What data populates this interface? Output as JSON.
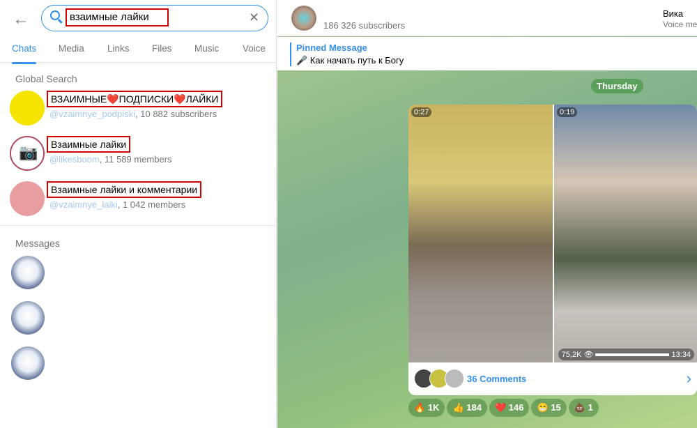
{
  "search": {
    "query": "взаимные лайки"
  },
  "tabs": [
    "Chats",
    "Media",
    "Links",
    "Files",
    "Music",
    "Voice"
  ],
  "global_search_label": "Global Search",
  "results": [
    {
      "title": "ВЗАИМНЫЕ❤️ПОДПИСКИ❤️ЛАЙКИ",
      "handle": "@vzaimnye_podpiski",
      "count": ", 10 882 subscribers"
    },
    {
      "title": "Взаимные лайки",
      "handle": "@likesboom",
      "count": ", 11 589 members"
    },
    {
      "title": "Взаимные лайки и комментарии",
      "handle": "@vzaimnye_laiki",
      "count": ", 1 042 members"
    }
  ],
  "messages_label": "Messages",
  "channel": {
    "subscribers": "186 326 subscribers",
    "right_name": "Вика",
    "right_status": "Voice me"
  },
  "pinned": {
    "title": "Pinned Message",
    "text": "🎤 Как начать путь к Богу"
  },
  "day_label": "Thursday",
  "post": {
    "dur1": "0:27",
    "dur2": "0:19",
    "views": "75,2K",
    "time": "13:34",
    "comments": "36 Comments"
  },
  "reactions": [
    {
      "emoji": "🔥",
      "count": "1K"
    },
    {
      "emoji": "👍",
      "count": "184"
    },
    {
      "emoji": "❤️",
      "count": "146"
    },
    {
      "emoji": "😁",
      "count": "15"
    },
    {
      "emoji": "💩",
      "count": "1"
    }
  ]
}
